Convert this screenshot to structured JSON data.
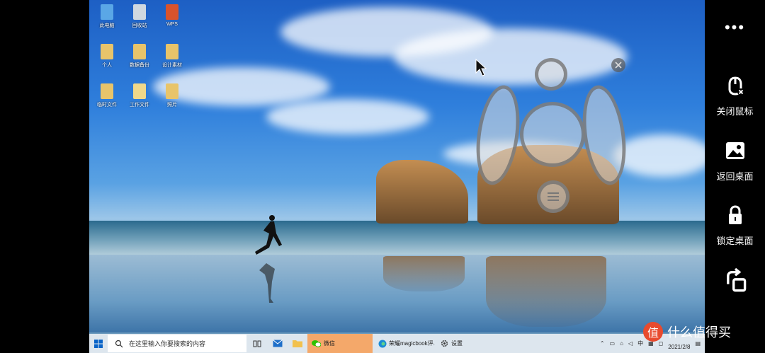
{
  "desktop_icons": [
    {
      "label": "此电脑",
      "color": "#5aa7e6"
    },
    {
      "label": "个人",
      "color": "#e8c46a"
    },
    {
      "label": "临时文件",
      "color": "#e8c46a"
    },
    {
      "label": "回收站",
      "color": "#cfd8e0"
    },
    {
      "label": "数据备份",
      "color": "#e8c46a"
    },
    {
      "label": "工作文件",
      "color": "#f0d88a"
    },
    {
      "label": "WPS",
      "color": "#d9532b"
    },
    {
      "label": "设计素材",
      "color": "#e8c46a"
    },
    {
      "label": "照片",
      "color": "#e8c46a"
    }
  ],
  "taskbar": {
    "search_placeholder": "在这里输入你要搜索的内容",
    "items": [
      {
        "label": "微信",
        "active": true
      },
      {
        "label": "荣耀magicbook评...",
        "active": false
      },
      {
        "label": "设置",
        "active": false
      }
    ],
    "tray": {
      "ime": "中",
      "date": "2021/2/8"
    }
  },
  "side_menu": {
    "more": "•••",
    "buttons": [
      {
        "label": "关闭鼠标",
        "icon": "mouse-close-icon"
      },
      {
        "label": "返回桌面",
        "icon": "desktop-image-icon"
      },
      {
        "label": "锁定桌面",
        "icon": "lock-icon"
      },
      {
        "label": "",
        "icon": "rotate-icon"
      }
    ]
  },
  "watermark": {
    "logo": "值",
    "text": "什么值得买"
  }
}
